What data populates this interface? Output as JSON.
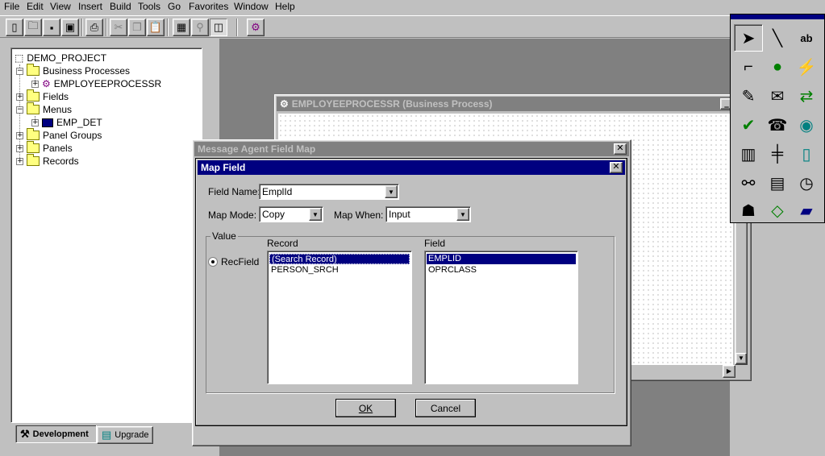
{
  "menu": [
    "File",
    "Edit",
    "View",
    "Insert",
    "Build",
    "Tools",
    "Go",
    "Favorites",
    "Window",
    "Help"
  ],
  "toolbar": {
    "icons": [
      "new-icon",
      "open-icon",
      "save-icon",
      "save-all-icon",
      "print-icon",
      "cut-icon",
      "copy-icon",
      "paste-icon",
      "project-icon",
      "find-icon",
      "properties-icon",
      "business-process-icon"
    ]
  },
  "tree": {
    "root": "DEMO_PROJECT",
    "business_processes": "Business Processes",
    "employee_process": "EMPLOYEEPROCESSR",
    "fields": "Fields",
    "menus": "Menus",
    "emp_det": "EMP_DET",
    "panel_groups": "Panel Groups",
    "panels": "Panels",
    "records": "Records"
  },
  "tabs": {
    "development": "Development",
    "upgrade": "Upgrade"
  },
  "bp_window": {
    "title": "EMPLOYEEPROCESSR (Business Process)"
  },
  "palette": {
    "text_tool": "ab",
    "icons": [
      "pointer-icon",
      "line-icon",
      "text-tool-icon",
      "connector-icon",
      "event-icon",
      "lightning-icon",
      "worklist-icon",
      "email-icon",
      "route-icon",
      "approve-icon",
      "phone-icon",
      "globe-icon",
      "kiosk-icon",
      "utility-pole-icon",
      "door-icon",
      "plug-icon",
      "panel-icon",
      "clock-doc-icon",
      "worker-icon",
      "decision-icon",
      "logo-icon"
    ]
  },
  "outer_dialog": {
    "title": "Message Agent Field Map"
  },
  "map_field": {
    "title": "Map Field",
    "field_name_label": "Field Name:",
    "field_name_value": "EmplId",
    "map_mode_label": "Map Mode:",
    "map_mode_value": "Copy",
    "map_when_label": "Map When:",
    "map_when_value": "Input",
    "value_group_label": "Value",
    "recfield_label": "RecField",
    "record_header": "Record",
    "field_header": "Field",
    "records": [
      "(Search Record)",
      "PERSON_SRCH"
    ],
    "fields": [
      "EMPLID",
      "OPRCLASS"
    ],
    "ok_label": "OK",
    "cancel_label": "Cancel"
  }
}
